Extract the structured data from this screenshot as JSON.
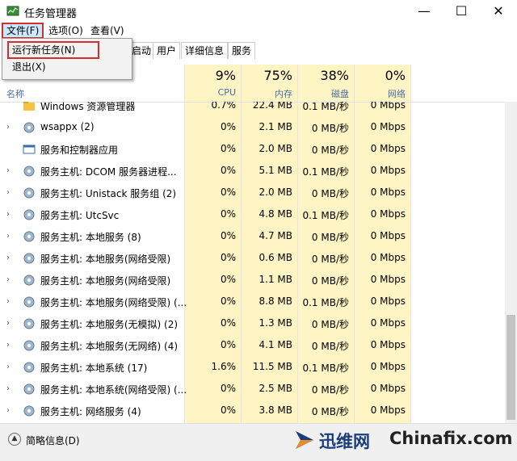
{
  "window": {
    "title": "任务管理器",
    "minimize": "—",
    "maximize": "☐",
    "close": "✕"
  },
  "menu": {
    "file": "文件(F)",
    "options": "选项(O)",
    "view": "查看(V)"
  },
  "dropdown": {
    "run_new_task": "运行新任务(N)",
    "exit": "退出(X)"
  },
  "tabs": [
    "启动",
    "用户",
    "详细信息",
    "服务"
  ],
  "header": {
    "name": "名称",
    "cpu_pct": "9%",
    "cpu": "CPU",
    "mem_pct": "75%",
    "mem": "内存",
    "disk_pct": "38%",
    "disk": "磁盘",
    "net_pct": "0%",
    "net": "网络"
  },
  "rows": [
    {
      "name": "Windows 资源管理器",
      "cpu": "0.7%",
      "mem": "22.4 MB",
      "disk": "0.1 MB/秒",
      "net": "0 Mbps"
    },
    {
      "name": "wsappx (2)",
      "cpu": "0%",
      "mem": "2.1 MB",
      "disk": "0 MB/秒",
      "net": "0 Mbps"
    },
    {
      "name": "服务和控制器应用",
      "cpu": "0%",
      "mem": "2.0 MB",
      "disk": "0 MB/秒",
      "net": "0 Mbps"
    },
    {
      "name": "服务主机: DCOM 服务器进程...",
      "cpu": "0%",
      "mem": "5.1 MB",
      "disk": "0.1 MB/秒",
      "net": "0 Mbps"
    },
    {
      "name": "服务主机: Unistack 服务组 (2)",
      "cpu": "0%",
      "mem": "2.0 MB",
      "disk": "0 MB/秒",
      "net": "0 Mbps"
    },
    {
      "name": "服务主机: UtcSvc",
      "cpu": "0%",
      "mem": "4.8 MB",
      "disk": "0.1 MB/秒",
      "net": "0 Mbps"
    },
    {
      "name": "服务主机: 本地服务 (8)",
      "cpu": "0%",
      "mem": "4.7 MB",
      "disk": "0 MB/秒",
      "net": "0 Mbps"
    },
    {
      "name": "服务主机: 本地服务(网络受限)",
      "cpu": "0%",
      "mem": "0.6 MB",
      "disk": "0 MB/秒",
      "net": "0 Mbps"
    },
    {
      "name": "服务主机: 本地服务(网络受限)",
      "cpu": "0%",
      "mem": "1.1 MB",
      "disk": "0 MB/秒",
      "net": "0 Mbps"
    },
    {
      "name": "服务主机: 本地服务(网络受限) (...",
      "cpu": "0%",
      "mem": "8.8 MB",
      "disk": "0.1 MB/秒",
      "net": "0 Mbps"
    },
    {
      "name": "服务主机: 本地服务(无模拟) (2)",
      "cpu": "0%",
      "mem": "1.3 MB",
      "disk": "0 MB/秒",
      "net": "0 Mbps"
    },
    {
      "name": "服务主机: 本地服务(无网络) (4)",
      "cpu": "0%",
      "mem": "4.1 MB",
      "disk": "0 MB/秒",
      "net": "0 Mbps"
    },
    {
      "name": "服务主机: 本地系统 (17)",
      "cpu": "1.6%",
      "mem": "11.5 MB",
      "disk": "0.1 MB/秒",
      "net": "0 Mbps"
    },
    {
      "name": "服务主机: 本地系统(网络受限) (...",
      "cpu": "0%",
      "mem": "2.5 MB",
      "disk": "0 MB/秒",
      "net": "0 Mbps"
    },
    {
      "name": "服务主机: 网络服务 (4)",
      "cpu": "0%",
      "mem": "3.8 MB",
      "disk": "0 MB/秒",
      "net": "0 Mbps"
    }
  ],
  "footer": {
    "less_details": "简略信息(D)"
  },
  "watermark": {
    "cn": "迅维网",
    "en": "Chinafix.com"
  }
}
